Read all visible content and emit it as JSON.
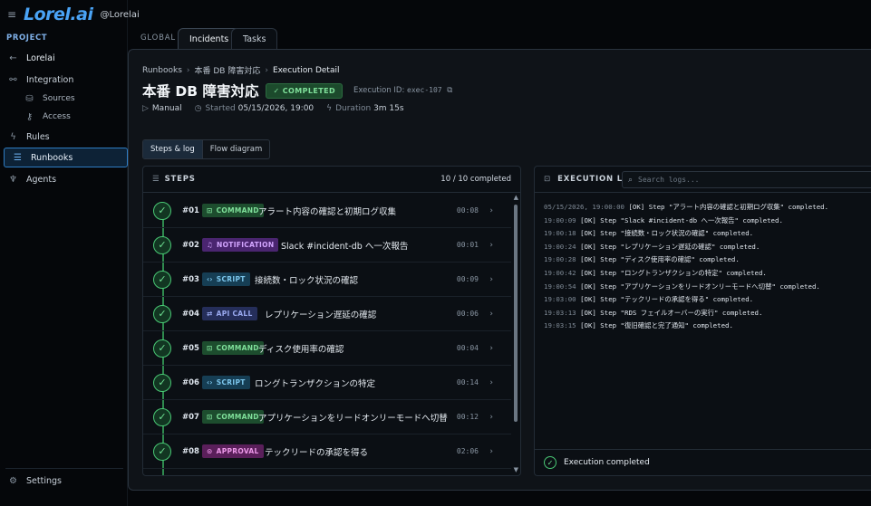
{
  "brand": {
    "logo": "Lorel.ai",
    "handle": "@Lorelai",
    "menu_icon": "hamburger-icon"
  },
  "sidebar": {
    "section_label": "PROJECT",
    "back_label": "Lorelai",
    "items": [
      {
        "label": "Integration",
        "icon": "plug-icon"
      },
      {
        "label": "Sources",
        "icon": "database-icon"
      },
      {
        "label": "Access",
        "icon": "key-icon"
      },
      {
        "label": "Rules",
        "icon": "bolt-icon"
      },
      {
        "label": "Runbooks",
        "icon": "list-icon"
      },
      {
        "label": "Agents",
        "icon": "agent-icon"
      }
    ],
    "settings_label": "Settings",
    "active_color": "#2e7cc2"
  },
  "top": {
    "global_label": "GLOBAL",
    "tabs": [
      {
        "label": "Incidents"
      },
      {
        "label": "Tasks"
      }
    ]
  },
  "breadcrumb": {
    "items": [
      "Runbooks",
      "本番 DB 障害対応",
      "Execution Detail"
    ]
  },
  "header": {
    "title": "本番 DB 障害対応",
    "status": "✓ COMPLETED",
    "exec_id_label": "Execution ID:",
    "exec_id": "exec-107",
    "trigger": "Manual",
    "started_label": "Started",
    "started_value": "05/15/2026, 19:00",
    "duration_label": "Duration",
    "duration_value": "3m 15s"
  },
  "view_toggle": {
    "steps_log": "Steps & log",
    "flow": "Flow diagram"
  },
  "steps": {
    "label": "STEPS",
    "count": "10 / 10 completed",
    "items": [
      {
        "num": "#01",
        "type": "COMMAND",
        "text": "アラート内容の確認と初期ログ収集",
        "dur": "00:08"
      },
      {
        "num": "#02",
        "type": "NOTIFICATION",
        "text": "Slack #incident-db へ一次報告",
        "dur": "00:01"
      },
      {
        "num": "#03",
        "type": "SCRIPT",
        "text": "接続数・ロック状況の確認",
        "dur": "00:09"
      },
      {
        "num": "#04",
        "type": "API CALL",
        "text": "レプリケーション遅延の確認",
        "dur": "00:06"
      },
      {
        "num": "#05",
        "type": "COMMAND",
        "text": "ディスク使用率の確認",
        "dur": "00:04"
      },
      {
        "num": "#06",
        "type": "SCRIPT",
        "text": "ロングトランザクションの特定",
        "dur": "00:14"
      },
      {
        "num": "#07",
        "type": "COMMAND",
        "text": "アプリケーションをリードオンリーモードへ切替",
        "dur": "00:12"
      },
      {
        "num": "#08",
        "type": "APPROVAL",
        "text": "テックリードの承認を得る",
        "dur": "02:06"
      }
    ]
  },
  "log": {
    "label": "EXECUTION LOG",
    "search_placeholder": "Search logs...",
    "lines": [
      {
        "ts": "05/15/2026, 19:00:00",
        "msg": "[OK] Step \"アラート内容の確認と初期ログ収集\" completed."
      },
      {
        "ts": "19:00:09",
        "msg": "[OK] Step \"Slack #incident-db へ一次報告\" completed."
      },
      {
        "ts": "19:00:18",
        "msg": "[OK] Step \"接続数・ロック状況の確認\" completed."
      },
      {
        "ts": "19:00:24",
        "msg": "[OK] Step \"レプリケーション遅延の確認\" completed."
      },
      {
        "ts": "19:00:28",
        "msg": "[OK] Step \"ディスク使用率の確認\" completed."
      },
      {
        "ts": "19:00:42",
        "msg": "[OK] Step \"ロングトランザクションの特定\" completed."
      },
      {
        "ts": "19:00:54",
        "msg": "[OK] Step \"アプリケーションをリードオンリーモードへ切替\" completed."
      },
      {
        "ts": "19:03:00",
        "msg": "[OK] Step \"テックリードの承認を得る\" completed."
      },
      {
        "ts": "19:03:13",
        "msg": "[OK] Step \"RDS フェイルオーバーの実行\" completed."
      },
      {
        "ts": "19:03:15",
        "msg": "[OK] Step \"復旧確認と完了通知\" completed."
      }
    ],
    "footer": "Execution completed"
  }
}
